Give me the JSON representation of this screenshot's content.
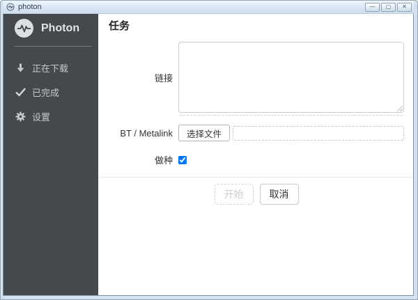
{
  "titlebar": {
    "title": "photon",
    "app_icon": "pulse-icon",
    "minimize_glyph": "—",
    "maximize_glyph": "▢",
    "close_glyph": "✕"
  },
  "sidebar": {
    "brand": "Photon",
    "logo_icon": "pulse-circle-icon",
    "items": [
      {
        "label": "正在下载",
        "icon": "download-icon"
      },
      {
        "label": "已完成",
        "icon": "check-icon"
      },
      {
        "label": "设置",
        "icon": "gear-icon"
      }
    ]
  },
  "main": {
    "heading": "任务",
    "form": {
      "link_label": "链接",
      "link_value": "",
      "bt_label": "BT / Metalink",
      "choose_file_label": "选择文件",
      "file_value": "",
      "seed_label": "做种",
      "seed_checked": "checked"
    },
    "actions": {
      "start_label": "开始",
      "cancel_label": "取消"
    }
  },
  "colors": {
    "sidebar_bg": "#46494c",
    "sidebar_text": "#c6c9cc",
    "titlebar_bg": "#d5e3f1",
    "frame_border": "#95a5b6",
    "control_border": "#cccccc",
    "disabled_text": "#c9ccd0",
    "dashed_border": "#bccadb"
  }
}
